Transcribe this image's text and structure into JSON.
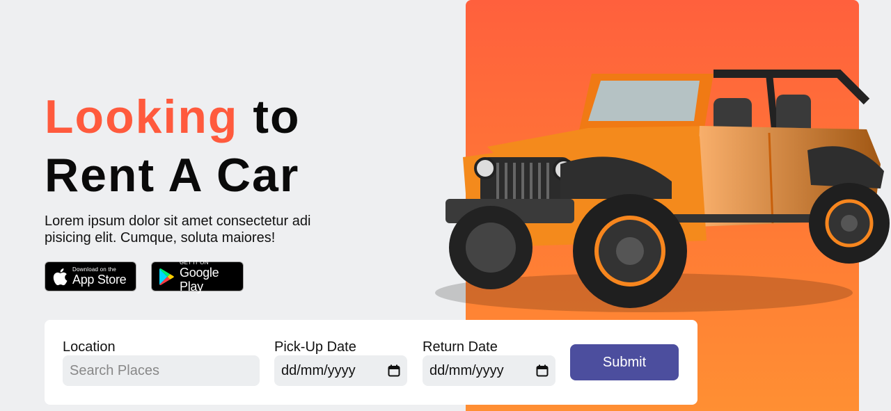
{
  "hero": {
    "title_accent": "Looking",
    "title_rest_line1": "to",
    "title_line2": "Rent A Car",
    "description": "Lorem ipsum dolor sit amet consectetur adi pisicing elit. Cumque, soluta maiores!"
  },
  "stores": {
    "apple": {
      "small": "Download on the",
      "big": "App Store"
    },
    "google": {
      "small": "GET IT ON",
      "big": "Google Play"
    }
  },
  "form": {
    "location_label": "Location",
    "location_placeholder": "Search Places",
    "pickup_label": "Pick-Up Date",
    "pickup_value": "dd/mm/yyyy",
    "return_label": "Return Date",
    "return_value": "dd/mm/yyyy",
    "submit_label": "Submit"
  },
  "colors": {
    "accent": "#ff5a3d",
    "panel_orange": "#ff7a35",
    "submit_purple": "#4c4e9e",
    "car_orange": "#f7861e"
  },
  "icons": [
    "apple-icon",
    "google-play-icon",
    "calendar-icon"
  ]
}
